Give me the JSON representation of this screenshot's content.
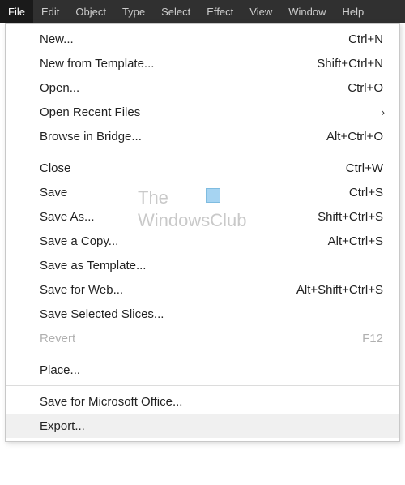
{
  "menubar": {
    "items": [
      {
        "label": "File",
        "active": true
      },
      {
        "label": "Edit"
      },
      {
        "label": "Object"
      },
      {
        "label": "Type"
      },
      {
        "label": "Select"
      },
      {
        "label": "Effect"
      },
      {
        "label": "View"
      },
      {
        "label": "Window"
      },
      {
        "label": "Help"
      }
    ]
  },
  "menu": {
    "groups": [
      [
        {
          "label": "New...",
          "shortcut": "Ctrl+N"
        },
        {
          "label": "New from Template...",
          "shortcut": "Shift+Ctrl+N"
        },
        {
          "label": "Open...",
          "shortcut": "Ctrl+O"
        },
        {
          "label": "Open Recent Files",
          "submenu": true
        },
        {
          "label": "Browse in Bridge...",
          "shortcut": "Alt+Ctrl+O"
        }
      ],
      [
        {
          "label": "Close",
          "shortcut": "Ctrl+W"
        },
        {
          "label": "Save",
          "shortcut": "Ctrl+S"
        },
        {
          "label": "Save As...",
          "shortcut": "Shift+Ctrl+S"
        },
        {
          "label": "Save a Copy...",
          "shortcut": "Alt+Ctrl+S"
        },
        {
          "label": "Save as Template..."
        },
        {
          "label": "Save for Web...",
          "shortcut": "Alt+Shift+Ctrl+S"
        },
        {
          "label": "Save Selected Slices..."
        },
        {
          "label": "Revert",
          "shortcut": "F12",
          "disabled": true
        }
      ],
      [
        {
          "label": "Place..."
        }
      ],
      [
        {
          "label": "Save for Microsoft Office..."
        },
        {
          "label": "Export...",
          "hover": true
        }
      ]
    ]
  },
  "watermark": {
    "line1": "The",
    "line2": "WindowsClub"
  }
}
